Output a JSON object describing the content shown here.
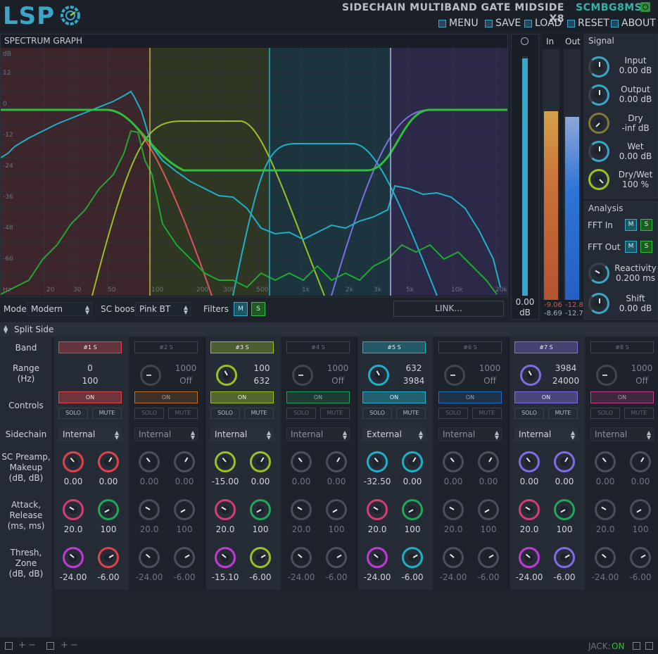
{
  "header": {
    "logo": "LSP",
    "plugin_title": "SIDECHAIN MULTIBAND GATE MIDSIDE X8",
    "plugin_code": "SCMBG8MS",
    "menu": [
      {
        "label": "MENU",
        "icon": "menu-icon"
      },
      {
        "label": "SAVE",
        "icon": "save-icon"
      },
      {
        "label": "LOAD",
        "icon": "load-icon"
      },
      {
        "label": "RESET",
        "icon": "reset-icon"
      },
      {
        "label": "ABOUT",
        "icon": "about-icon"
      }
    ]
  },
  "spectrum": {
    "title": "SPECTRUM GRAPH",
    "db_labels": [
      "dB",
      "12",
      "0",
      "-12",
      "-24",
      "-36",
      "-48",
      "-60"
    ],
    "hz_labels": [
      "Hz",
      "20",
      "30",
      "50",
      "100",
      "200",
      "300",
      "500",
      "1k",
      "2k",
      "3k",
      "5k",
      "10k",
      "20k"
    ]
  },
  "level": {
    "value": "0.00",
    "unit": "dB",
    "fill_fraction": 0.99
  },
  "meters": {
    "in_label": "In",
    "out_label": "Out",
    "in_values": [
      "-9.06",
      "-8.69"
    ],
    "out_values": [
      "-12.8",
      "-12.7"
    ],
    "in_fraction": 0.76,
    "out_fraction": 0.74
  },
  "signal": {
    "title": "Signal",
    "knobs": [
      {
        "label": "Input",
        "value": "0.00 dB"
      },
      {
        "label": "Output",
        "value": "0.00 dB"
      },
      {
        "label": "Dry",
        "value": "-inf dB"
      },
      {
        "label": "Wet",
        "value": "0.00 dB"
      },
      {
        "label": "Dry/Wet",
        "value": "100 %"
      }
    ]
  },
  "analysis": {
    "title": "Analysis",
    "fft_in": "FFT In",
    "fft_out": "FFT Out",
    "m": "M",
    "s": "S",
    "knobs": [
      {
        "label": "Reactivity",
        "value": "0.200 ms"
      },
      {
        "label": "Shift",
        "value": "0.00 dB"
      }
    ]
  },
  "mode_bar": {
    "mode_label": "Mode:",
    "mode_value": "Modern",
    "scboost_label": "SC boost:",
    "scboost_value": "Pink BT",
    "filters_label": "Filters",
    "filter_m": "M",
    "filter_s": "S",
    "link_label": "LINK..."
  },
  "split": {
    "label": "Split Side"
  },
  "row_labels": {
    "band": "Band",
    "range": [
      "Range",
      "(Hz)"
    ],
    "controls": "Controls",
    "sidechain": "Sidechain",
    "preamp": [
      "SC Preamp,",
      "Makeup",
      "(dB, dB)"
    ],
    "attack": [
      "Attack,",
      "Release",
      "(ms, ms)"
    ],
    "thresh": [
      "Thresh,",
      "Zone",
      "(dB, dB)"
    ]
  },
  "band_common": {
    "on": "ON",
    "solo": "SOLO",
    "mute": "MUTE"
  },
  "bands": [
    {
      "name": "#1 S",
      "color": "#e0424a",
      "active": true,
      "range_lo": "0",
      "range_hi": "100",
      "has_knob": false,
      "sidechain": "Internal",
      "preamp": "0.00",
      "makeup": "0.00",
      "attack": "20.0",
      "release": "100",
      "thresh": "-24.00",
      "zone": "-6.00"
    },
    {
      "name": "#2 S",
      "color": "#c06a22",
      "active": false,
      "range_lo": "1000",
      "range_hi": "Off",
      "has_knob": true,
      "sidechain": "Internal",
      "preamp": "0.00",
      "makeup": "0.00",
      "attack": "20.0",
      "release": "100",
      "thresh": "-24.00",
      "zone": "-6.00"
    },
    {
      "name": "#3 S",
      "color": "#9cbf24",
      "active": true,
      "range_lo": "100",
      "range_hi": "632",
      "has_knob": true,
      "sidechain": "Internal",
      "preamp": "-15.00",
      "makeup": "0.00",
      "attack": "20.0",
      "release": "100",
      "thresh": "-15.10",
      "zone": "-6.00"
    },
    {
      "name": "#4 S",
      "color": "#1f9b53",
      "active": false,
      "range_lo": "1000",
      "range_hi": "Off",
      "has_knob": true,
      "sidechain": "Internal",
      "preamp": "0.00",
      "makeup": "0.00",
      "attack": "20.0",
      "release": "100",
      "thresh": "-24.00",
      "zone": "-6.00"
    },
    {
      "name": "#5 S",
      "color": "#1fb0c8",
      "active": true,
      "range_lo": "632",
      "range_hi": "3984",
      "has_knob": true,
      "sidechain": "External",
      "preamp": "-32.50",
      "makeup": "0.00",
      "attack": "20.0",
      "release": "100",
      "thresh": "-24.00",
      "zone": "-6.00"
    },
    {
      "name": "#6 S",
      "color": "#1c6cc4",
      "active": false,
      "range_lo": "1000",
      "range_hi": "Off",
      "has_knob": true,
      "sidechain": "Internal",
      "preamp": "0.00",
      "makeup": "0.00",
      "attack": "20.0",
      "release": "100",
      "thresh": "-24.00",
      "zone": "-6.00"
    },
    {
      "name": "#7 S",
      "color": "#7d6ee6",
      "active": true,
      "range_lo": "3984",
      "range_hi": "24000",
      "has_knob": true,
      "sidechain": "Internal",
      "preamp": "0.00",
      "makeup": "0.00",
      "attack": "20.0",
      "release": "100",
      "thresh": "-24.00",
      "zone": "-6.00"
    },
    {
      "name": "#8 S",
      "color": "#c23a8a",
      "active": false,
      "range_lo": "1000",
      "range_hi": "Off",
      "has_knob": true,
      "sidechain": "Internal",
      "preamp": "0.00",
      "makeup": "0.00",
      "attack": "20.0",
      "release": "100",
      "thresh": "-24.00",
      "zone": "-6.00"
    }
  ],
  "footer": {
    "jack_label": "JACK:",
    "jack_value": "ON"
  }
}
